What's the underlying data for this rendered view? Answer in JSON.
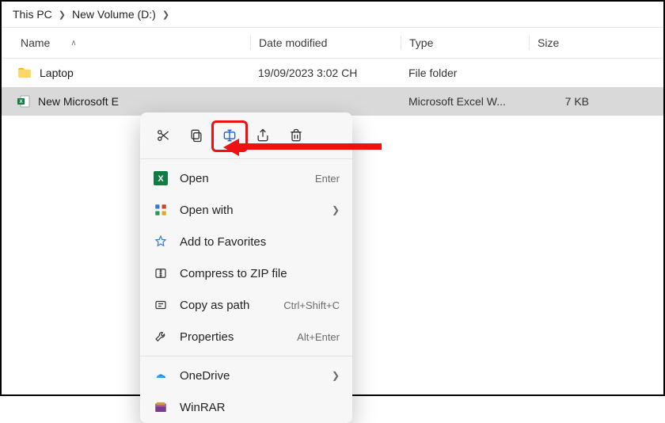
{
  "breadcrumb": {
    "seg1": "This PC",
    "seg2": "New Volume (D:)"
  },
  "headers": {
    "name": "Name",
    "date": "Date modified",
    "type": "Type",
    "size": "Size"
  },
  "rows": [
    {
      "name": "Laptop",
      "date": "19/09/2023 3:02 CH",
      "type": "File folder",
      "size": ""
    },
    {
      "name": "New Microsoft E",
      "date": "",
      "type": "Microsoft Excel W...",
      "size": "7 KB"
    }
  ],
  "ctx": {
    "open": "Open",
    "open_sc": "Enter",
    "openwith": "Open with",
    "favorites": "Add to Favorites",
    "zip": "Compress to ZIP file",
    "copypath": "Copy as path",
    "copypath_sc": "Ctrl+Shift+C",
    "properties": "Properties",
    "properties_sc": "Alt+Enter",
    "onedrive": "OneDrive",
    "winrar": "WinRAR"
  }
}
